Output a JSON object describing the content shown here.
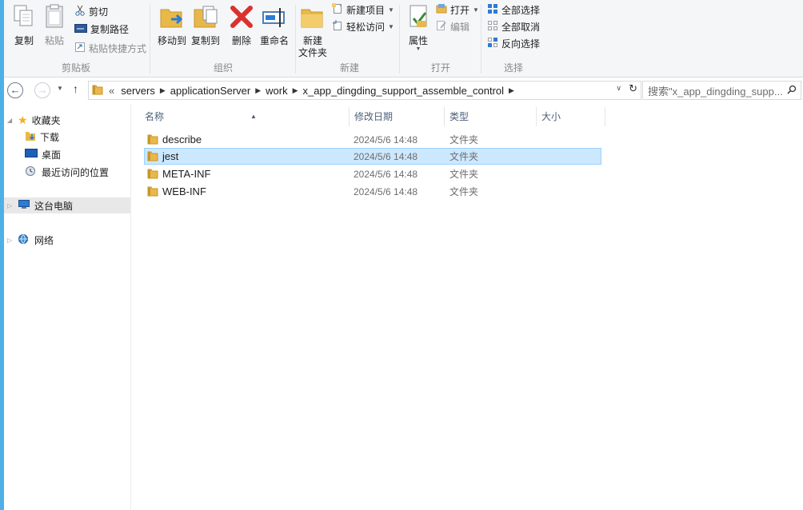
{
  "ribbon": {
    "clipboard": {
      "group_label": "剪贴板",
      "copy": "复制",
      "paste": "粘贴",
      "cut": "剪切",
      "copy_path": "复制路径",
      "paste_shortcut": "粘贴快捷方式"
    },
    "organize": {
      "group_label": "组织",
      "move_to": "移动到",
      "copy_to": "复制到",
      "delete": "删除",
      "rename": "重命名"
    },
    "new": {
      "group_label": "新建",
      "new_folder_line1": "新建",
      "new_folder_line2": "文件夹",
      "new_item": "新建项目",
      "easy_access": "轻松访问"
    },
    "open": {
      "group_label": "打开",
      "properties": "属性",
      "open": "打开",
      "edit": "编辑"
    },
    "select": {
      "group_label": "选择",
      "select_all": "全部选择",
      "select_none": "全部取消",
      "invert_selection": "反向选择"
    }
  },
  "address": {
    "overflow": "«",
    "crumbs": [
      "servers",
      "applicationServer",
      "work",
      "x_app_dingding_support_assemble_control"
    ],
    "search_placeholder": "搜索\"x_app_dingding_supp..."
  },
  "nav": {
    "favorites": "收藏夹",
    "downloads": "下载",
    "desktop": "桌面",
    "recent": "最近访问的位置",
    "this_pc": "这台电脑",
    "network": "网络"
  },
  "columns": {
    "name": "名称",
    "modified": "修改日期",
    "type": "类型",
    "size": "大小"
  },
  "files": [
    {
      "name": "describe",
      "modified": "2024/5/6 14:48",
      "type": "文件夹",
      "selected": false
    },
    {
      "name": "jest",
      "modified": "2024/5/6 14:48",
      "type": "文件夹",
      "selected": true
    },
    {
      "name": "META-INF",
      "modified": "2024/5/6 14:48",
      "type": "文件夹",
      "selected": false
    },
    {
      "name": "WEB-INF",
      "modified": "2024/5/6 14:48",
      "type": "文件夹",
      "selected": false
    }
  ],
  "colors": {
    "accent": "#4fb0e8",
    "selection": "#cce8ff",
    "folder": "#e8b84a",
    "delete_red": "#d9322f"
  }
}
